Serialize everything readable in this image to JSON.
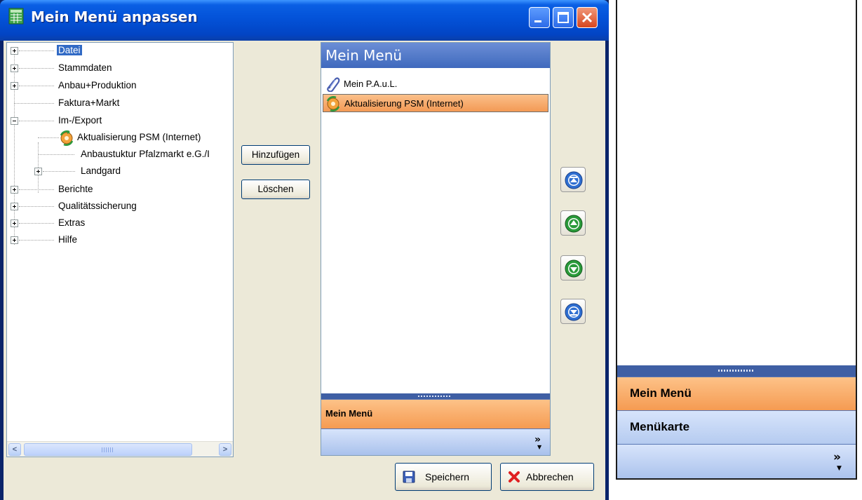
{
  "window": {
    "title": "Mein Menü anpassen",
    "icons": {
      "app": "spreadsheet-icon",
      "minimize": "minimize-icon",
      "maximize": "maximize-icon",
      "close": "close-icon"
    }
  },
  "tree": {
    "items": [
      {
        "label": "Datei",
        "expander": "plus",
        "selected": true
      },
      {
        "label": "Stammdaten",
        "expander": "plus"
      },
      {
        "label": "Anbau+Produktion",
        "expander": "plus"
      },
      {
        "label": "Faktura+Markt",
        "expander": "none"
      },
      {
        "label": "Im-/Export",
        "expander": "minus"
      },
      {
        "label": "Aktualisierung PSM (Internet)",
        "icon": "update-gear-icon"
      },
      {
        "label": "Anbaustuktur Pfalzmarkt e.G./I"
      },
      {
        "label": "Landgard",
        "expander": "plus"
      },
      {
        "label": "Berichte",
        "expander": "plus"
      },
      {
        "label": "Qualitätssicherung",
        "expander": "plus"
      },
      {
        "label": "Extras",
        "expander": "plus"
      },
      {
        "label": "Hilfe",
        "expander": "plus"
      }
    ],
    "scrollbar": {
      "left_glyph": "<",
      "right_glyph": ">"
    }
  },
  "actions": {
    "add_label": "Hinzufügen",
    "delete_label": "Löschen"
  },
  "my_menu": {
    "header": "Mein Menü",
    "items": [
      {
        "label": "Mein P.A.u.L.",
        "icon": "paperclip-icon",
        "selected": false
      },
      {
        "label": "Aktualisierung PSM (Internet)",
        "icon": "update-gear-icon",
        "selected": true
      }
    ],
    "nav_active": "Mein Menü",
    "overflow_glyph": "»"
  },
  "order_buttons": [
    {
      "name": "move-top-button",
      "icon": "move-top-icon",
      "color": "#2f6fd1"
    },
    {
      "name": "move-up-button",
      "icon": "move-up-icon",
      "color": "#2a9a3a"
    },
    {
      "name": "move-down-button",
      "icon": "move-down-icon",
      "color": "#2a9a3a"
    },
    {
      "name": "move-bottom-button",
      "icon": "move-bottom-icon",
      "color": "#2f6fd1"
    }
  ],
  "footer": {
    "save_label": "Speichern",
    "cancel_label": "Abbrechen"
  },
  "side_panel": {
    "nav_items": [
      "Mein Menü",
      "Menükarte"
    ],
    "active_index": 0,
    "overflow_glyph": "»"
  },
  "colors": {
    "selection": "#316ac5",
    "active_nav": "#f59b52",
    "nav_blue": "#b5cbf0",
    "titlebar": "#0352d8"
  }
}
